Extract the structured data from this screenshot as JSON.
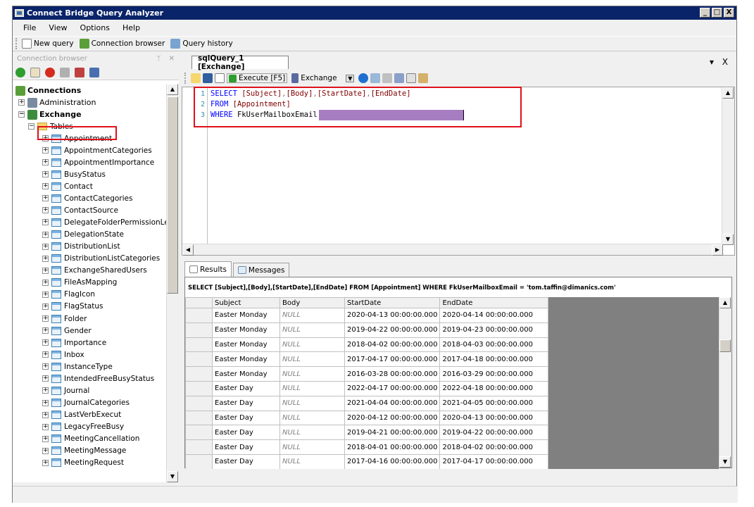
{
  "app_title": "Connect Bridge Query Analyzer",
  "window_buttons": {
    "minimize": "_",
    "maximize": "□",
    "close": "X"
  },
  "menu": [
    "File",
    "View",
    "Options",
    "Help"
  ],
  "toolbar": {
    "new_query": "New query",
    "connection_browser": "Connection browser",
    "query_history": "Query history"
  },
  "connection_browser": {
    "title": "Connection browser",
    "pin": "ᛘ",
    "close": "✕",
    "tree": {
      "root": "Connections",
      "administration": "Administration",
      "exchange": "Exchange",
      "tables_folder": "Tables",
      "tables": [
        "Appointment",
        "AppointmentCategories",
        "AppointmentImportance",
        "BusyStatus",
        "Contact",
        "ContactCategories",
        "ContactSource",
        "DelegateFolderPermissionLeve",
        "DelegationState",
        "DistributionList",
        "DistributionListCategories",
        "ExchangeSharedUsers",
        "FileAsMapping",
        "FlagIcon",
        "FlagStatus",
        "Folder",
        "Gender",
        "Importance",
        "Inbox",
        "InstanceType",
        "IntendedFreeBusyStatus",
        "Journal",
        "JournalCategories",
        "LastVerbExecut",
        "LegacyFreeBusy",
        "MeetingCancellation",
        "MeetingMessage",
        "MeetingRequest"
      ]
    }
  },
  "query_tab": {
    "title": "sqlQuery_1 [Exchange]",
    "dropdown": "▾",
    "close": "X"
  },
  "query_toolbar": {
    "execute": "Execute [F5]",
    "connection": "Exchange"
  },
  "editor": {
    "line_numbers": [
      "1",
      "2",
      "3"
    ],
    "line1": {
      "kw": "SELECT",
      "cols": [
        "[Subject]",
        "[Body]",
        "[StartDate]",
        "[EndDate]"
      ]
    },
    "line2": {
      "kw": "FROM",
      "table": "[Appointment]"
    },
    "line3": {
      "kw": "WHERE",
      "field": "FkUserMailboxEmail"
    }
  },
  "result_tabs": {
    "results": "Results",
    "messages": "Messages"
  },
  "results": {
    "sql": "SELECT [Subject],[Body],[StartDate],[EndDate]  FROM [Appointment] WHERE FkUserMailboxEmail = 'tom.taffin@dimanics.com'",
    "columns": [
      "Subject",
      "Body",
      "StartDate",
      "EndDate"
    ],
    "rows": [
      [
        "Easter Monday",
        "NULL",
        "2020-04-13 00:00:00.000",
        "2020-04-14 00:00:00.000"
      ],
      [
        "Easter Monday",
        "NULL",
        "2019-04-22 00:00:00.000",
        "2019-04-23 00:00:00.000"
      ],
      [
        "Easter Monday",
        "NULL",
        "2018-04-02 00:00:00.000",
        "2018-04-03 00:00:00.000"
      ],
      [
        "Easter Monday",
        "NULL",
        "2017-04-17 00:00:00.000",
        "2017-04-18 00:00:00.000"
      ],
      [
        "Easter Monday",
        "NULL",
        "2016-03-28 00:00:00.000",
        "2016-03-29 00:00:00.000"
      ],
      [
        "Easter Day",
        "NULL",
        "2022-04-17 00:00:00.000",
        "2022-04-18 00:00:00.000"
      ],
      [
        "Easter Day",
        "NULL",
        "2021-04-04 00:00:00.000",
        "2021-04-05 00:00:00.000"
      ],
      [
        "Easter Day",
        "NULL",
        "2020-04-12 00:00:00.000",
        "2020-04-13 00:00:00.000"
      ],
      [
        "Easter Day",
        "NULL",
        "2019-04-21 00:00:00.000",
        "2019-04-22 00:00:00.000"
      ],
      [
        "Easter Day",
        "NULL",
        "2018-04-01 00:00:00.000",
        "2018-04-02 00:00:00.000"
      ],
      [
        "Easter Day",
        "NULL",
        "2017-04-16 00:00:00.000",
        "2017-04-17 00:00:00.000"
      ]
    ]
  },
  "colors": {
    "highlight_box": "#e0101a",
    "redaction": "#a77dc1",
    "keyword": "#0000ff",
    "title_bar": "#0a246a"
  }
}
